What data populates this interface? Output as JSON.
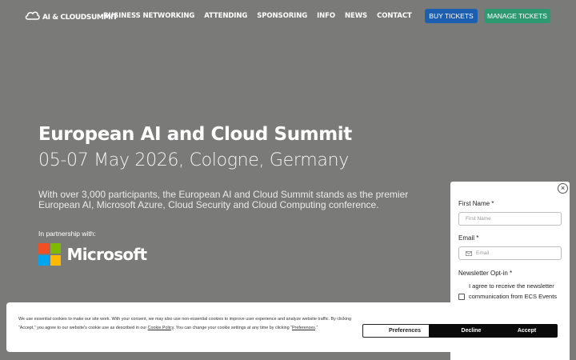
{
  "header": {
    "logo_text": "AI & CLOUDSUMMIT",
    "nav": [
      "BUSINESS NETWORKING",
      "ATTENDING",
      "SPONSORING",
      "INFO",
      "NEWS",
      "CONTACT"
    ],
    "buy_tickets": "BUY TICKETS",
    "manage_tickets": "MANAGE TICKETS"
  },
  "hero": {
    "title": "European AI and Cloud Summit",
    "subtitle": "05-07 May 2026, Cologne, Germany",
    "description": "With over 3,000 participants, the European AI and Cloud Summit stands as the premier European AI, Microsoft Azure, Cloud Security and Cloud Computing conference.",
    "partner_label": "In partnership with:",
    "partner_name": "Microsoft"
  },
  "form": {
    "close": "×",
    "first_name_label": "First Name *",
    "first_name_placeholder": "First Name",
    "email_label": "Email *",
    "email_placeholder": "Email",
    "newsletter_label": "Newsletter Opt-in *",
    "consent_text": "I agree to receive the newsletter communication from ECS Events"
  },
  "cookie": {
    "text_1": "We use essential cookies to make our site work. With your consent, we may also use non-essential cookies to improve user experience and analyze website traffic. By clicking “Accept,” you agree to our website's cookie use as described in our ",
    "policy_link": "Cookie Policy",
    "text_2": ". You can change your cookie settings at any time by clicking “",
    "prefs_link": "Preferences",
    "text_3": ".”",
    "preferences": "Preferences",
    "decline": "Decline",
    "accept": "Accept"
  },
  "colors": {
    "background": "#7a7b79",
    "buy_button": "#1c5fb0",
    "manage_button": "#2e9a72",
    "ms_red": "#f25022",
    "ms_green": "#7fba00",
    "ms_blue": "#00a4ef",
    "ms_yellow": "#ffb900"
  },
  "icons": [
    "cloud-logo-icon",
    "close-icon",
    "mail-icon",
    "microsoft-logo-icon"
  ]
}
